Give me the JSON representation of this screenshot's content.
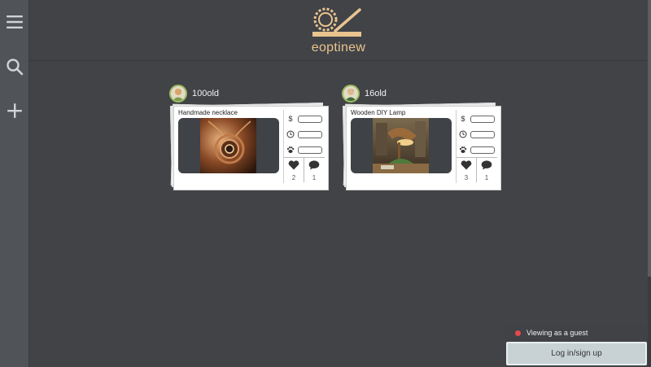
{
  "sidebar": {
    "menu_icon": "hamburger-menu-icon",
    "search_icon": "search-icon",
    "add_icon": "plus-icon"
  },
  "header": {
    "brand": "eoptinew",
    "logo_icon": "sawblade-logo-icon"
  },
  "cards": [
    {
      "owner": "100old",
      "title": "Handmade necklace",
      "likes": "2",
      "comments": "1"
    },
    {
      "owner": "16old",
      "title": "Wooden DIY Lamp",
      "likes": "3",
      "comments": "1"
    }
  ],
  "meta_icons": [
    "dollar-icon",
    "clock-icon",
    "paw-icon"
  ],
  "guest": {
    "status": "Viewing as a guest",
    "login_label": "Log in/sign up"
  },
  "colors": {
    "background": "#414347",
    "accent": "#e9c48f",
    "guest_dot": "#e5484d"
  }
}
